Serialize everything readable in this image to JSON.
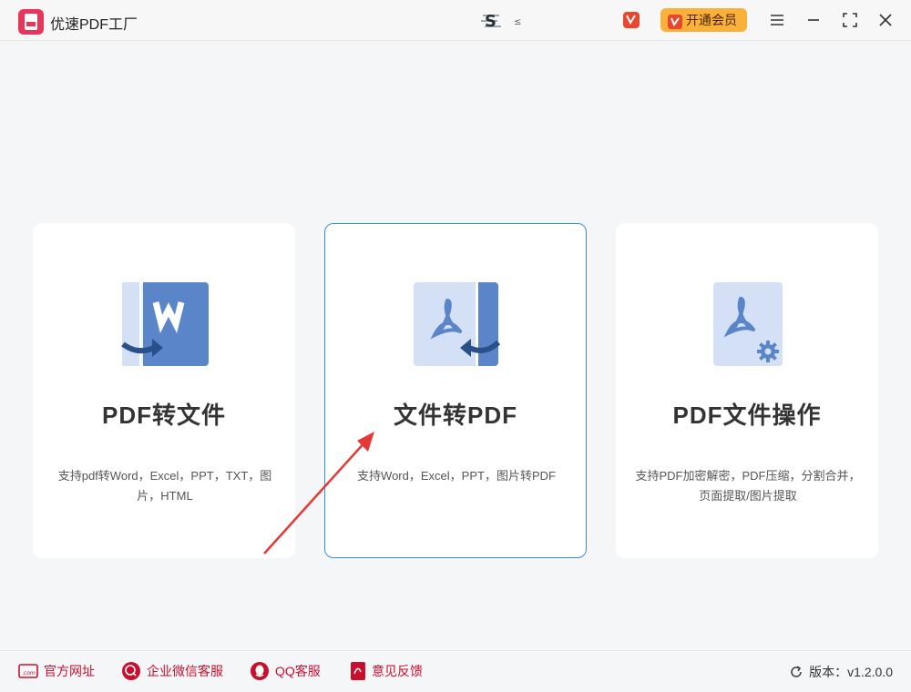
{
  "titlebar": {
    "app_name": "优速PDF工厂",
    "center_logo_text": "S",
    "vip_label": "开通会员"
  },
  "cards": [
    {
      "title": "PDF转文件",
      "description": "支持pdf转Word，Excel，PPT，TXT，图片，HTML",
      "icon": "pdf-to-word-icon"
    },
    {
      "title": "文件转PDF",
      "description": "支持Word，Excel，PPT，图片转PDF",
      "icon": "file-to-pdf-icon"
    },
    {
      "title": "PDF文件操作",
      "description": "支持PDF加密解密，PDF压缩，分割合并，页面提取/图片提取",
      "icon": "pdf-operations-icon"
    }
  ],
  "footer": {
    "links": [
      "官方网址",
      "企业微信客服",
      "QQ客服",
      "意见反馈"
    ],
    "version": "版本：v1.2.0.0"
  },
  "colors": {
    "accent_blue": "#3a90d8",
    "icon_blue": "#5a86c9",
    "icon_light": "#d3e0f5",
    "vip_orange": "#f9b13a",
    "footer_red": "#c8102e",
    "annotation_red": "#e53935"
  }
}
